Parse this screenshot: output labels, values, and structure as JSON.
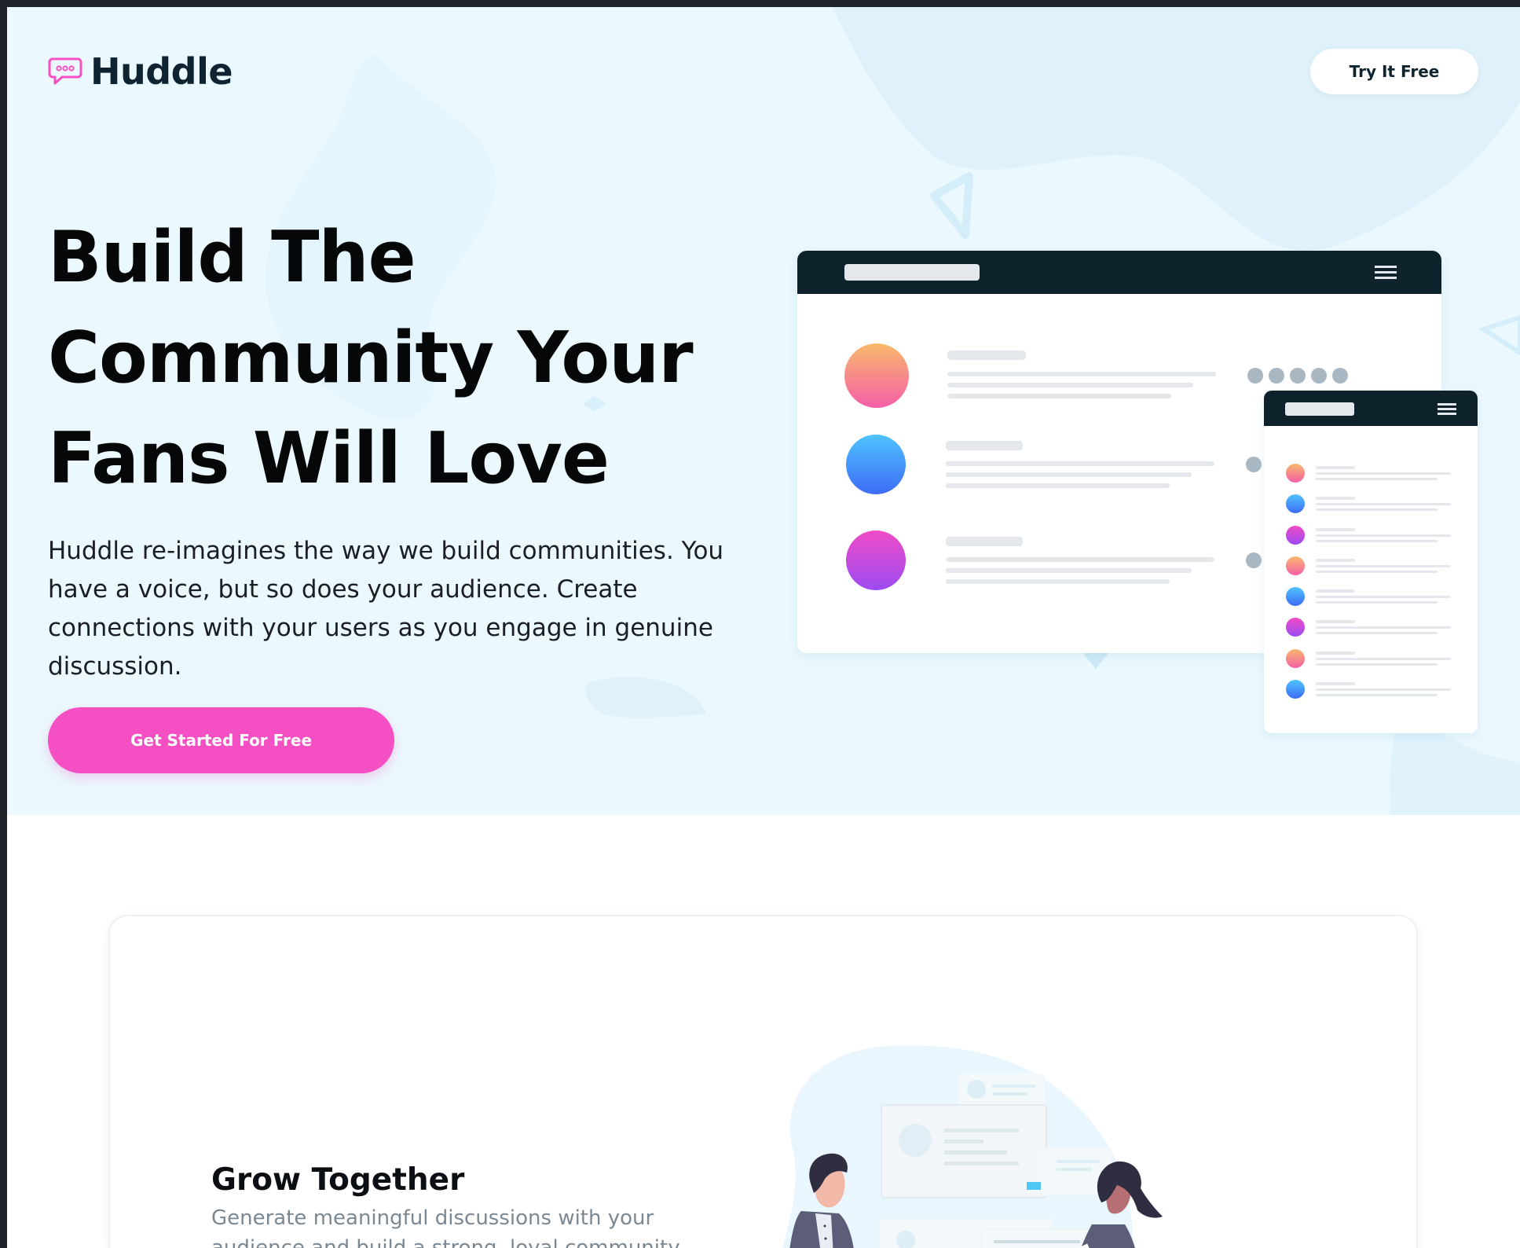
{
  "brand": {
    "name": "Huddle",
    "accent": "#f450c3",
    "dark": "#0e2430",
    "hero_bg": "#ebf8fd"
  },
  "header": {
    "logo_icon": "chat-bubble-icon",
    "try_button": "Try It Free"
  },
  "hero": {
    "headline_lines": [
      "Build The",
      "Community Your",
      "Fans Will Love"
    ],
    "description": "Huddle re-imagines the way we build communities. You have a voice, but so does your audience. Create connections with your users as you engage in genuine discussion.",
    "cta": "Get Started For Free"
  },
  "feature": {
    "title": "Grow Together",
    "text": "Generate meaningful discussions with your audience and build a strong, loyal community."
  },
  "mockup": {
    "menu_icon": "hamburger-menu-icon",
    "avatar_colors": [
      "#f78f8f",
      "#4aa8ff",
      "#e04bd8"
    ]
  }
}
